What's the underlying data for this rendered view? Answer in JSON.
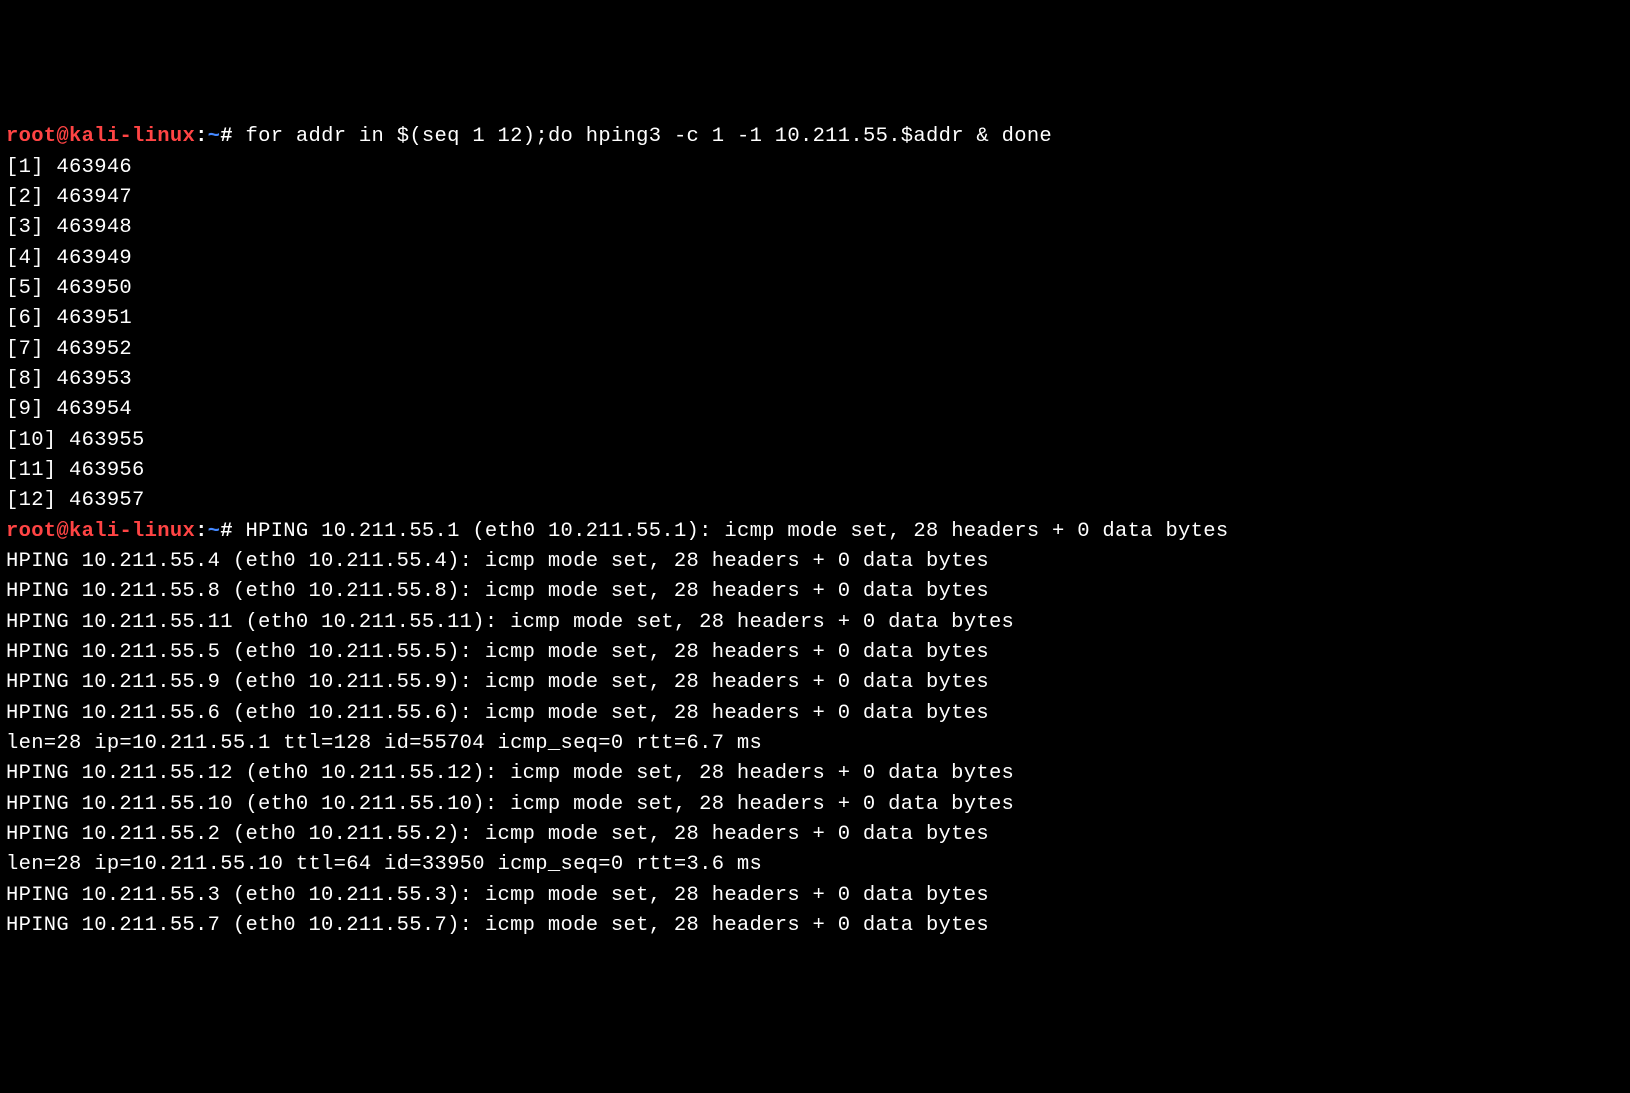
{
  "prompt": {
    "user": "root",
    "at": "@",
    "host": "kali-linux",
    "colon": ":",
    "tilde": "~",
    "hash": "#"
  },
  "command1": " for addr in $(seq 1 12);do hping3 -c 1 -1 10.211.55.$addr & done",
  "jobs": [
    "[1] 463946",
    "[2] 463947",
    "[3] 463948",
    "[4] 463949",
    "[5] 463950",
    "[6] 463951",
    "[7] 463952",
    "[8] 463953",
    "[9] 463954",
    "[10] 463955",
    "[11] 463956",
    "[12] 463957"
  ],
  "output_after_prompt2": " HPING 10.211.55.1 (eth0 10.211.55.1): icmp mode set, 28 headers + 0 data bytes",
  "output_lines": [
    "HPING 10.211.55.4 (eth0 10.211.55.4): icmp mode set, 28 headers + 0 data bytes",
    "HPING 10.211.55.8 (eth0 10.211.55.8): icmp mode set, 28 headers + 0 data bytes",
    "HPING 10.211.55.11 (eth0 10.211.55.11): icmp mode set, 28 headers + 0 data bytes",
    "HPING 10.211.55.5 (eth0 10.211.55.5): icmp mode set, 28 headers + 0 data bytes",
    "HPING 10.211.55.9 (eth0 10.211.55.9): icmp mode set, 28 headers + 0 data bytes",
    "HPING 10.211.55.6 (eth0 10.211.55.6): icmp mode set, 28 headers + 0 data bytes",
    "len=28 ip=10.211.55.1 ttl=128 id=55704 icmp_seq=0 rtt=6.7 ms",
    "HPING 10.211.55.12 (eth0 10.211.55.12): icmp mode set, 28 headers + 0 data bytes",
    "HPING 10.211.55.10 (eth0 10.211.55.10): icmp mode set, 28 headers + 0 data bytes",
    "HPING 10.211.55.2 (eth0 10.211.55.2): icmp mode set, 28 headers + 0 data bytes",
    "len=28 ip=10.211.55.10 ttl=64 id=33950 icmp_seq=0 rtt=3.6 ms",
    "HPING 10.211.55.3 (eth0 10.211.55.3): icmp mode set, 28 headers + 0 data bytes",
    "HPING 10.211.55.7 (eth0 10.211.55.7): icmp mode set, 28 headers + 0 data bytes"
  ]
}
